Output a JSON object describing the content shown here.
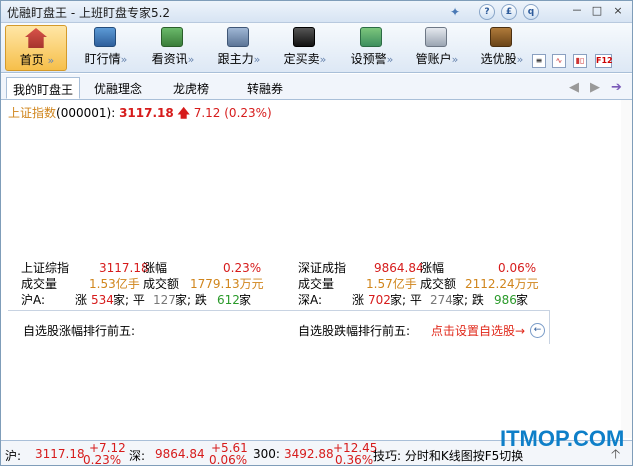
{
  "window": {
    "title": "优融盯盘王 - 上班盯盘专家5.2"
  },
  "title_buttons": [
    "?",
    "£",
    "q"
  ],
  "window_controls": [
    "－",
    "□",
    "×"
  ],
  "toolbar": [
    {
      "label": "首页",
      "icon": "home-icon",
      "active": true
    },
    {
      "label": "盯行情",
      "icon": "monitor-chart-icon"
    },
    {
      "label": "看资讯",
      "icon": "newspaper-icon"
    },
    {
      "label": "跟主力",
      "icon": "tools-icon"
    },
    {
      "label": "定买卖",
      "icon": "money-icon"
    },
    {
      "label": "设预警",
      "icon": "alarm-chart-icon"
    },
    {
      "label": "管账户",
      "icon": "calculator-icon"
    },
    {
      "label": "选优股",
      "icon": "stocks-icon"
    }
  ],
  "toolbar_arrow": "»",
  "mini_buttons": [
    "list-icon",
    "wave-icon",
    "candles-icon",
    "F12"
  ],
  "tabs": [
    "我的盯盘王",
    "优融理念",
    "龙虎榜",
    "转融券"
  ],
  "index_line": {
    "name": "上证指数",
    "code": "(000001):",
    "value": "3117.18",
    "change": "7.12 (0.23%)"
  },
  "shanghai": {
    "r1": {
      "l1": "上证综指",
      "v1": "3117.18",
      "l2": "涨幅",
      "v2": "0.23%"
    },
    "r2": {
      "l1": "成交量",
      "v1": "1.53亿手",
      "l2": "成交额",
      "v2": "1779.13万元"
    },
    "r3": {
      "l1": "沪A:",
      "up_l": "涨",
      "up": "534",
      "flat_l": "家; 平",
      "flat": "127",
      "down_l": "家; 跌",
      "down": "612",
      "end": "家"
    }
  },
  "shenzhen": {
    "r1": {
      "l1": "深证成指",
      "v1": "9864.84",
      "l2": "涨幅",
      "v2": "0.06%"
    },
    "r2": {
      "l1": "成交量",
      "v1": "1.57亿手",
      "l2": "成交额",
      "v2": "2112.24万元"
    },
    "r3": {
      "l1": "深A:",
      "up_l": "涨",
      "up": "702",
      "flat_l": "家; 平",
      "flat": "274",
      "down_l": "家; 跌",
      "down": "986",
      "end": "家"
    }
  },
  "top_gainers_label": "自选股涨幅排行前五:",
  "top_losers_label": "自选股跌幅排行前五:",
  "set_link": "点击设置自选股→",
  "status": {
    "sh_label": "沪:",
    "sh_value": "3117.18",
    "sh_change": "+7.12",
    "sh_pct": "0.23%",
    "sz_label": "深:",
    "sz_value": "9864.84",
    "sz_change": "+5.61",
    "sz_pct": "0.06%",
    "h_label": "300:",
    "h_value": "3492.88",
    "h_change": "+12.45",
    "h_pct": "0.36%",
    "tip": "技巧: 分时和K线图按F5切换"
  },
  "watermark": "ITMOP.COM"
}
